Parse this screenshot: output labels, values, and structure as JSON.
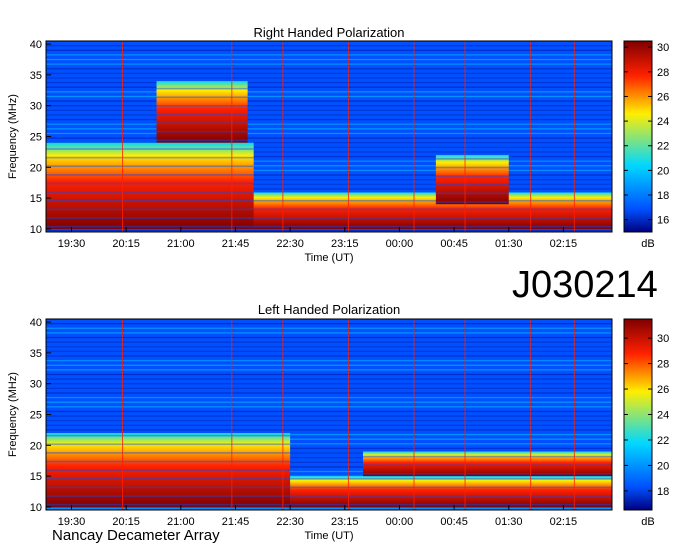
{
  "station_id": "J030214",
  "credit": "Nancay Decameter Array",
  "colors": {
    "low": "#00007f",
    "mid_low": "#0050ff",
    "mid": "#00d8ff",
    "mid_high": "#ffee00",
    "high": "#ff2000",
    "max": "#7f0000"
  },
  "chart_data": [
    {
      "type": "heatmap",
      "title": "Right Handed Polarization",
      "xlabel": "Time (UT)",
      "ylabel": "Frequency (MHz)",
      "x_ticks": [
        "19:30",
        "20:15",
        "21:00",
        "21:45",
        "22:30",
        "23:15",
        "00:00",
        "00:45",
        "01:30",
        "02:15"
      ],
      "y_ticks": [
        10,
        15,
        20,
        25,
        30,
        35,
        40
      ],
      "ylim": [
        9.5,
        40.5
      ],
      "colorbar": {
        "label": "dB",
        "ticks": [
          16,
          18,
          20,
          22,
          24,
          26,
          28,
          30
        ],
        "range": [
          15,
          30.5
        ]
      },
      "vertical_markers": [
        "20:12",
        "21:42",
        "22:24",
        "23:18",
        "00:12",
        "00:54",
        "01:48",
        "02:24"
      ],
      "emission_regions": [
        {
          "time_start": "19:09",
          "time_end": "22:00",
          "freq_min": 10,
          "freq_max": 24
        },
        {
          "time_start": "22:00",
          "time_end": "02:55",
          "freq_min": 10,
          "freq_max": 16
        },
        {
          "time_start": "00:30",
          "time_end": "01:30",
          "freq_min": 14,
          "freq_max": 22
        },
        {
          "time_start": "20:40",
          "time_end": "21:55",
          "freq_min": 24,
          "freq_max": 34
        }
      ]
    },
    {
      "type": "heatmap",
      "title": "Left Handed Polarization",
      "xlabel": "Time (UT)",
      "ylabel": "Frequency (MHz)",
      "x_ticks": [
        "19:30",
        "20:15",
        "21:00",
        "21:45",
        "22:30",
        "23:15",
        "00:00",
        "00:45",
        "01:30",
        "02:15"
      ],
      "y_ticks": [
        10,
        15,
        20,
        25,
        30,
        35,
        40
      ],
      "ylim": [
        9.5,
        40.5
      ],
      "colorbar": {
        "label": "dB",
        "ticks": [
          18,
          20,
          22,
          24,
          26,
          28,
          30
        ],
        "range": [
          16.5,
          31.5
        ]
      },
      "vertical_markers": [
        "20:12",
        "21:42",
        "22:24",
        "23:18",
        "00:12",
        "00:54",
        "01:48",
        "02:24"
      ],
      "emission_regions": [
        {
          "time_start": "19:09",
          "time_end": "22:30",
          "freq_min": 10,
          "freq_max": 22
        },
        {
          "time_start": "22:30",
          "time_end": "02:55",
          "freq_min": 10,
          "freq_max": 15
        },
        {
          "time_start": "23:30",
          "time_end": "02:55",
          "freq_min": 15,
          "freq_max": 19
        }
      ]
    }
  ]
}
